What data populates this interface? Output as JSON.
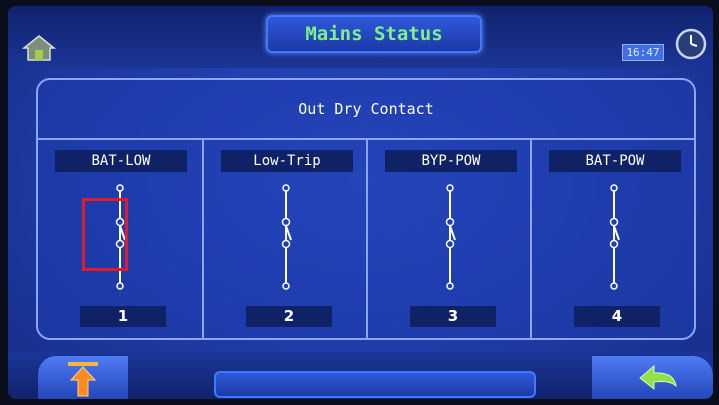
{
  "header": {
    "title": "Mains Status",
    "time": "16:47"
  },
  "panel": {
    "title": "Out Dry Contact",
    "contacts": [
      {
        "label": "BAT-LOW",
        "number": "1",
        "selected": true
      },
      {
        "label": "Low-Trip",
        "number": "2",
        "selected": false
      },
      {
        "label": "BYP-POW",
        "number": "3",
        "selected": false
      },
      {
        "label": "BAT-POW",
        "number": "4",
        "selected": false
      }
    ]
  },
  "footer": {
    "status": ""
  },
  "icons": {
    "home": "home-icon",
    "clock": "clock-icon",
    "up": "arrow-up-icon",
    "back": "back-arrow-icon"
  },
  "colors": {
    "title_text": "#7cf08a",
    "highlight": "#e01c2b",
    "panel_border": "#8aa6ff"
  }
}
